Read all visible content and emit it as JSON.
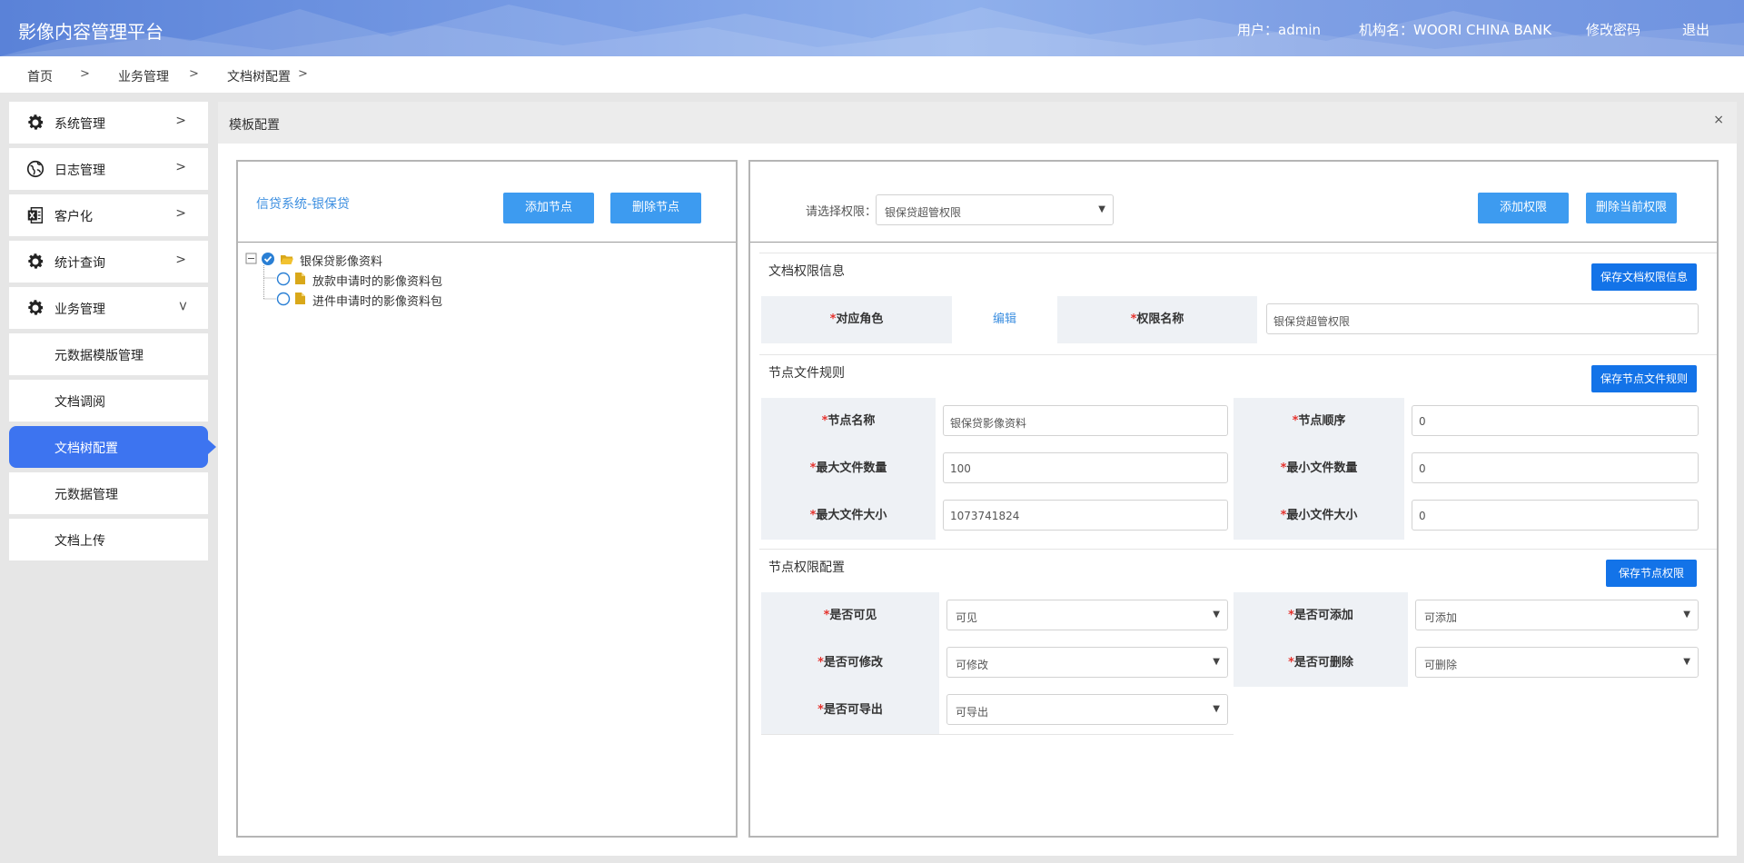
{
  "header": {
    "title": "影像内容管理平台",
    "user": "用户：admin",
    "org": "机构名：WOORI CHINA BANK",
    "change_password": "修改密码",
    "logout": "退出"
  },
  "breadcrumb": [
    "首页",
    "业务管理",
    "文档树配置"
  ],
  "sidebar": {
    "menus": [
      {
        "label": "系统管理",
        "icon": "gear-icon"
      },
      {
        "label": "日志管理",
        "icon": "globe-icon"
      },
      {
        "label": "客户化",
        "icon": "excel-icon"
      },
      {
        "label": "统计查询",
        "icon": "gear-icon"
      },
      {
        "label": "业务管理",
        "icon": "gear-icon"
      }
    ],
    "sub_items": [
      "元数据模版管理",
      "文档调阅",
      "文档树配置",
      "元数据管理",
      "文档上传"
    ],
    "active": "文档树配置"
  },
  "panel": {
    "title": "模板配置",
    "close": "×"
  },
  "tree_panel": {
    "system_name": "信贷系统-银保贷",
    "add_node": "添加节点",
    "delete_node": "删除节点",
    "root": "银保贷影像资料",
    "children": [
      "放款申请时的影像资料包",
      "进件申请时的影像资料包"
    ]
  },
  "perm_panel": {
    "select_label": "请选择权限：",
    "select_value": "银保贷超管权限",
    "add_perm": "添加权限",
    "delete_perm": "删除当前权限",
    "doc_perm": {
      "title": "文档权限信息",
      "save": "保存文档权限信息",
      "role_label": "对应角色",
      "role_edit": "编辑",
      "perm_name_label": "权限名称",
      "perm_name_value": "银保贷超管权限"
    },
    "node_rule": {
      "title": "节点文件规则",
      "save": "保存节点文件规则",
      "node_name_label": "节点名称",
      "node_name_value": "银保贷影像资料",
      "node_order_label": "节点顺序",
      "node_order_value": "0",
      "max_count_label": "最大文件数量",
      "max_count_value": "100",
      "min_count_label": "最小文件数量",
      "min_count_value": "0",
      "max_size_label": "最大文件大小",
      "max_size_value": "1073741824",
      "min_size_label": "最小文件大小",
      "min_size_value": "0"
    },
    "node_perm": {
      "title": "节点权限配置",
      "save": "保存节点权限",
      "visible_label": "是否可见",
      "visible_value": "可见",
      "addable_label": "是否可添加",
      "addable_value": "可添加",
      "editable_label": "是否可修改",
      "editable_value": "可修改",
      "deletable_label": "是否可删除",
      "deletable_value": "可删除",
      "exportable_label": "是否可导出",
      "exportable_value": "可导出"
    }
  },
  "colors": {
    "header": "#6f93e0",
    "active": "#3d74f0",
    "button": "#3d9bf0",
    "button_dark": "#1373e8",
    "required": "#e5322d"
  }
}
